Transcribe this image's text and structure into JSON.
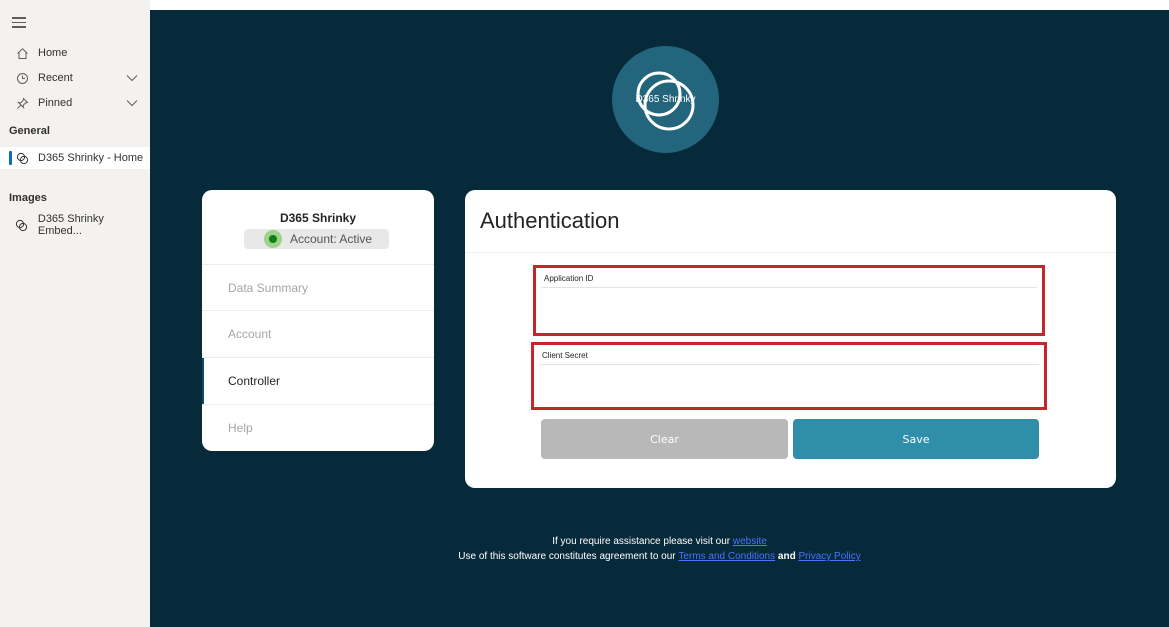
{
  "sidebar": {
    "home_label": "Home",
    "recent_label": "Recent",
    "pinned_label": "Pinned",
    "general_heading": "General",
    "general_item_label": "D365 Shrinky - Home",
    "images_heading": "Images",
    "images_item_label": "D365 Shrinky Embed..."
  },
  "logo": {
    "text": "D365 Shrinky"
  },
  "profile_card": {
    "app_name": "D365 Shrinky",
    "status_text": "Account: Active",
    "menu": [
      {
        "label": "Data Summary"
      },
      {
        "label": "Account"
      },
      {
        "label": "Controller"
      },
      {
        "label": "Help"
      }
    ]
  },
  "auth_card": {
    "title": "Authentication",
    "application_id_label": "Application ID",
    "application_id_value": "",
    "client_secret_label": "Client Secret",
    "client_secret_value": "",
    "clear_label": "Clear",
    "save_label": "Save"
  },
  "footer": {
    "line1_text": "If you require assistance please visit our",
    "website_link": "website",
    "line2_text": "Use of this software constitutes agreement to our",
    "terms_link": "Terms and Conditions",
    "and_text": "and",
    "privacy_link": "Privacy Policy"
  },
  "colors": {
    "main_background": "#062a3a",
    "logo_circle": "#23657d",
    "save_button": "#2f8fab",
    "clear_button": "#b8b8b8",
    "highlight_border": "#c4262e",
    "status_active": "#127d12",
    "link": "#4a73ff"
  },
  "icons": {
    "menu": "hamburger-icon",
    "home": "home-icon",
    "recent": "clock-icon",
    "pinned": "pin-icon",
    "app": "shrinky-app-icon",
    "expand": "chevron-down-icon"
  }
}
